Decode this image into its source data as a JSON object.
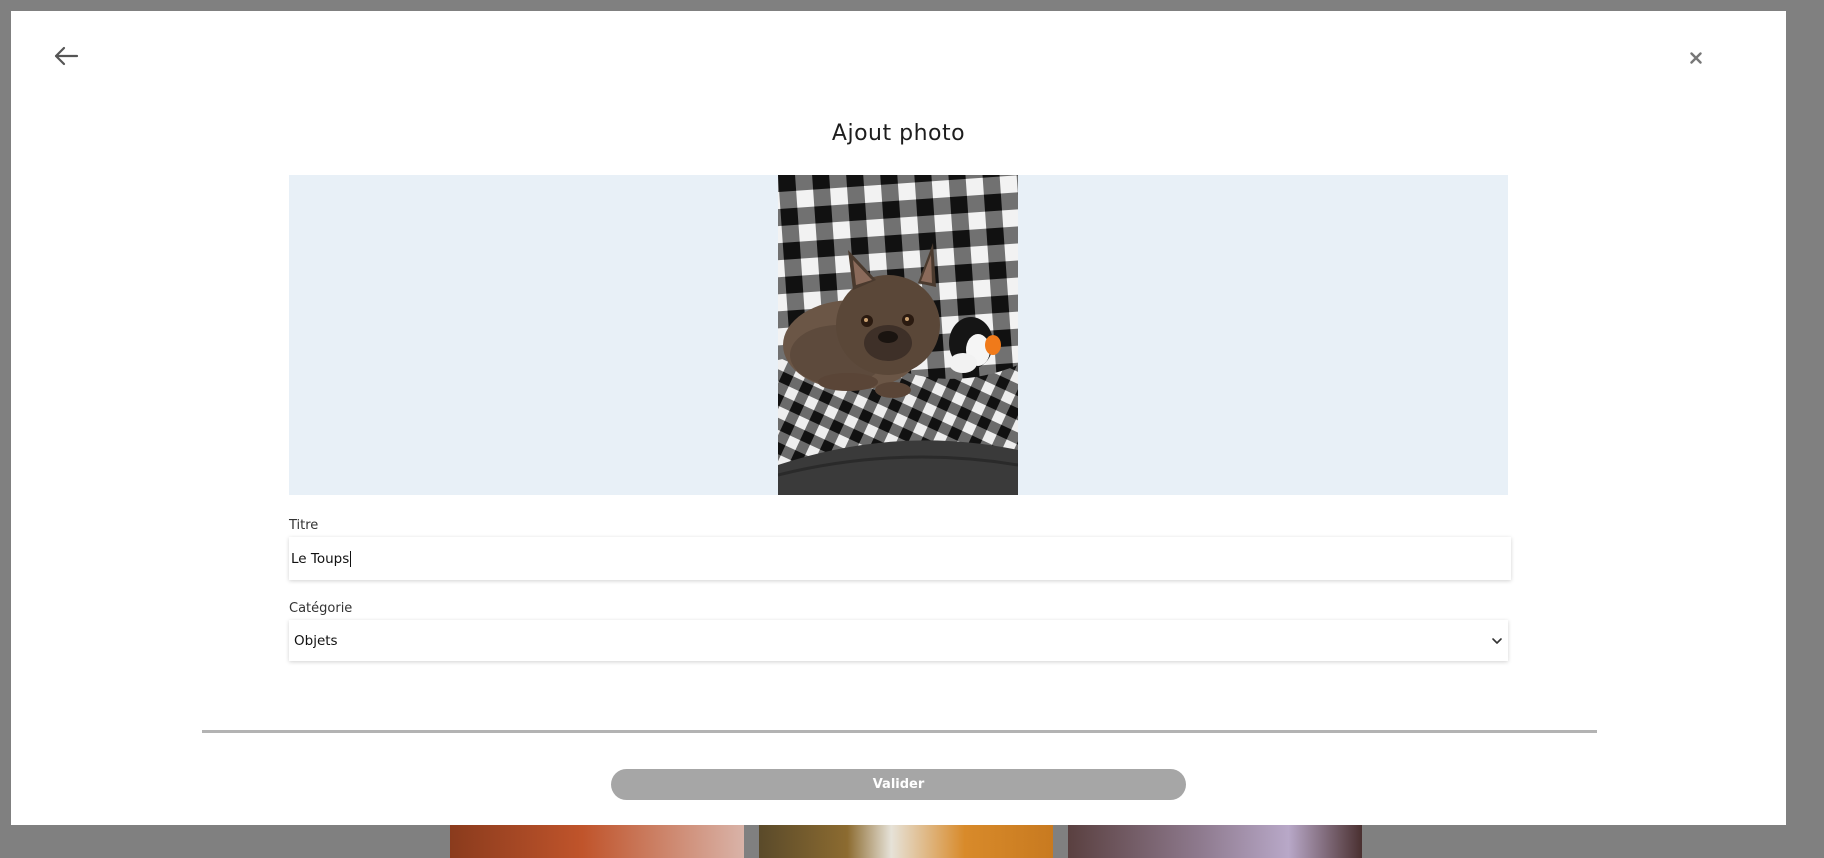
{
  "modal": {
    "title": "Ajout photo",
    "back_icon": "arrow-left-icon",
    "close_icon": "close-icon"
  },
  "form": {
    "titre_label": "Titre",
    "titre_value": "Le Toups",
    "categorie_label": "Catégorie",
    "categorie_value": "Objets",
    "submit_label": "Valider"
  },
  "colors": {
    "overlay": "#808080",
    "photo_bg": "#e8f0f7",
    "submit_disabled": "#a6a6a6",
    "divider": "#b3b3b3"
  }
}
